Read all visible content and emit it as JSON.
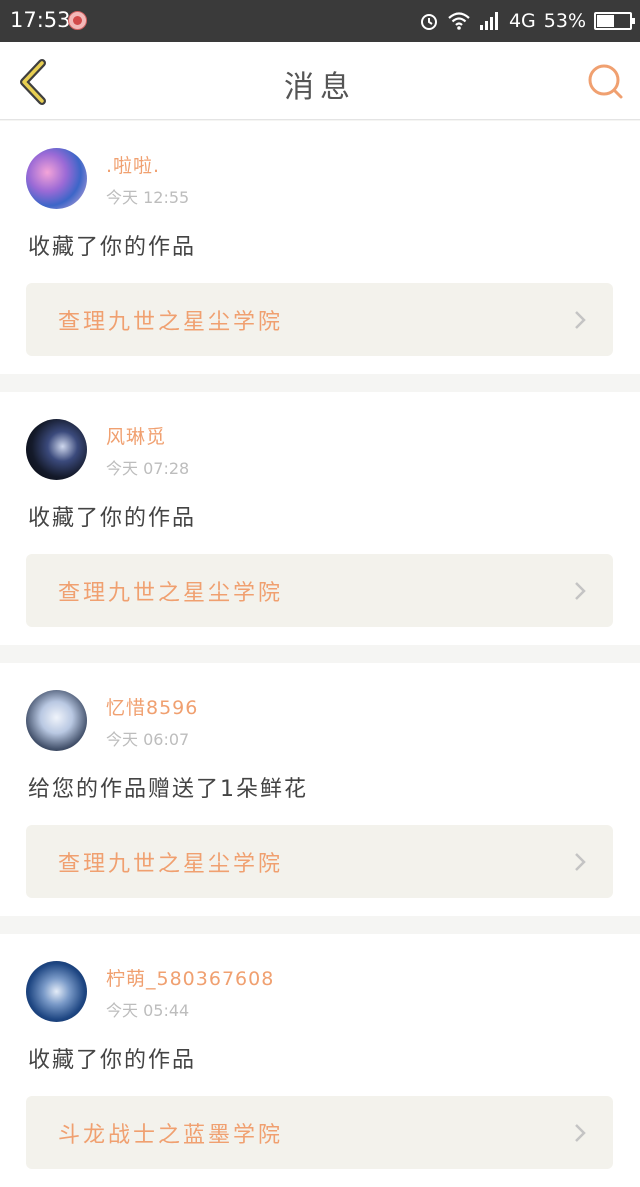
{
  "status_bar": {
    "time": "17:53",
    "network": "4G",
    "battery": "53%",
    "battery_level": 0.53,
    "icons": [
      "notification-app-icon",
      "alarm-icon",
      "wifi-icon",
      "signal-icon",
      "battery-icon"
    ]
  },
  "nav": {
    "title": "消息",
    "back_icon": "chevron-left-icon",
    "search_icon": "search-icon",
    "accent_color": "#f0a070"
  },
  "messages": [
    {
      "username": ".啦啦.",
      "time": "今天 12:55",
      "action": "收藏了你的作品",
      "work": "查理九世之星尘学院"
    },
    {
      "username": "风琳觅",
      "time": "今天 07:28",
      "action": "收藏了你的作品",
      "work": "查理九世之星尘学院"
    },
    {
      "username": "忆惜8596",
      "time": "今天 06:07",
      "action": "给您的作品赠送了1朵鲜花",
      "work": "查理九世之星尘学院"
    },
    {
      "username": "柠萌_580367608",
      "time": "今天 05:44",
      "action": "收藏了你的作品",
      "work": "斗龙战士之蓝墨学院"
    }
  ]
}
